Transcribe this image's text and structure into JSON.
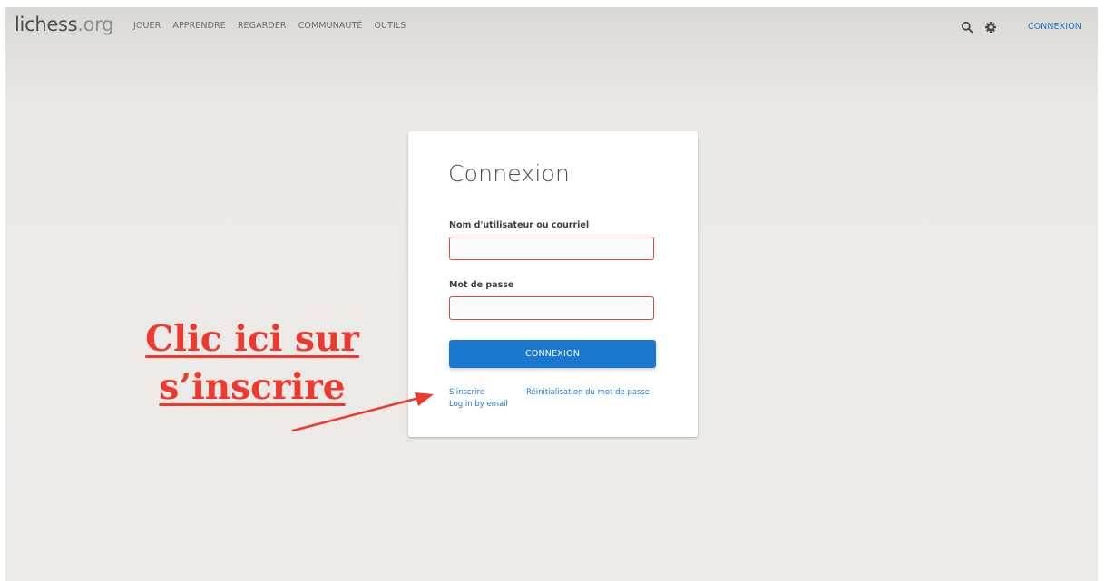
{
  "header": {
    "logo": {
      "name": "lichess",
      "tld": ".org"
    },
    "nav": [
      "JOUER",
      "APPRENDRE",
      "REGARDER",
      "COMMUNAUTÉ",
      "OUTILS"
    ],
    "icons": [
      "search-icon",
      "gear-icon"
    ],
    "signin_label": "CONNEXION"
  },
  "login": {
    "title": "Connexion",
    "username_label": "Nom d'utilisateur ou courriel",
    "username_value": "",
    "password_label": "Mot de passe",
    "password_value": "",
    "submit_label": "CONNEXION",
    "register_link": "S'inscrire",
    "reset_link": "Réinitialisation du mot de passe",
    "email_login_link": "Log in by email"
  },
  "annotation": {
    "line1": "Clic ici sur",
    "line2": "s’inscrire",
    "color": "#ee3a2e"
  },
  "colors": {
    "accent": "#1b78d0",
    "error_border": "#d74c4c",
    "background": "#ecebe8"
  }
}
